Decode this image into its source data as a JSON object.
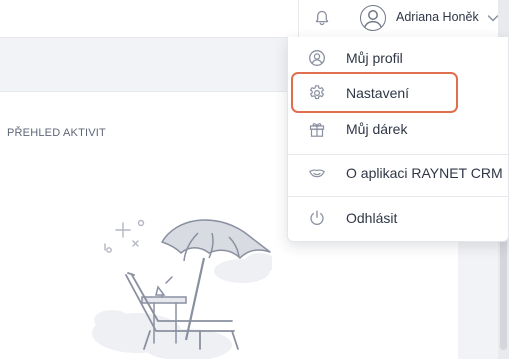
{
  "header": {
    "user_name": "Adriana Honěk",
    "icons": {
      "notifications": "bell-icon",
      "avatar": "user-avatar-icon",
      "menu": "chevron-down-icon"
    }
  },
  "main": {
    "section_title": "PŘEHLED AKTIVIT",
    "illustration": "beach-umbrella-illustration"
  },
  "user_menu": {
    "items": [
      {
        "label": "Můj profil",
        "icon": "user-circle-icon"
      },
      {
        "label": "Nastavení",
        "icon": "gear-icon",
        "highlighted": true
      },
      {
        "label": "Můj dárek",
        "icon": "gift-icon"
      },
      {
        "label": "O aplikaci RAYNET CRM",
        "icon": "raynet-logo-icon"
      },
      {
        "label": "Odhlásit",
        "icon": "power-icon"
      }
    ]
  },
  "colors": {
    "highlight": "#e06f4f",
    "text": "#2f3645",
    "icon": "#8a90a0",
    "band": "#f2f3f6"
  }
}
